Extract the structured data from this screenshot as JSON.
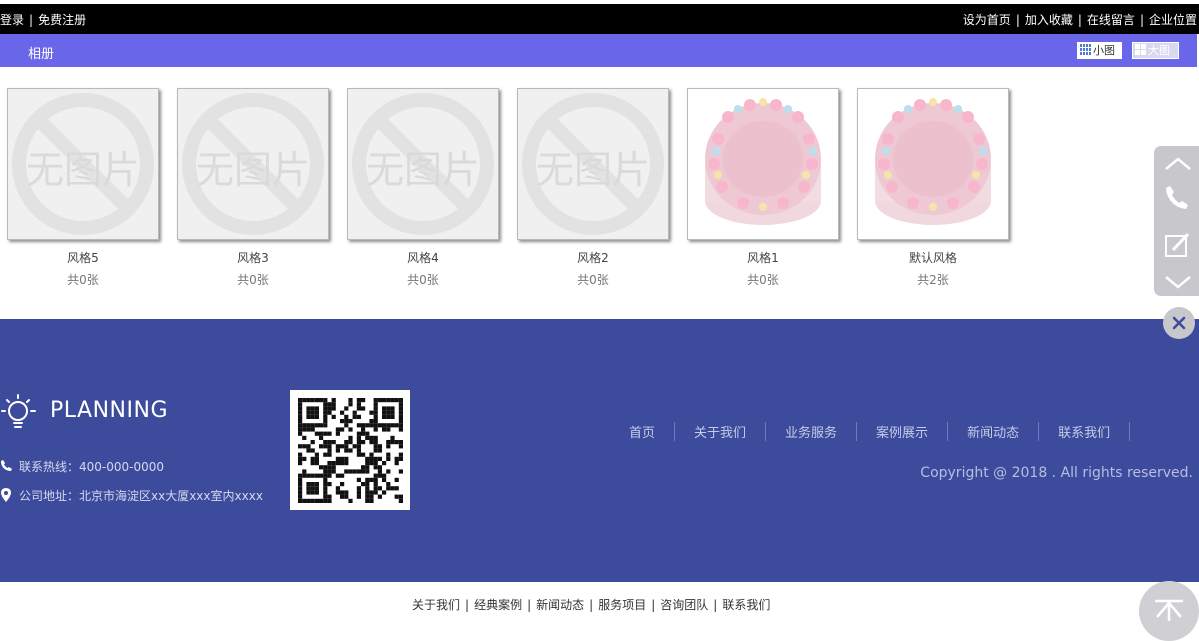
{
  "topbar": {
    "login": "登录",
    "register": "免费注册",
    "set_home": "设为首页",
    "favorite": "加入收藏",
    "message": "在线留言",
    "location": "企业位置",
    "sep": "|"
  },
  "album": {
    "title": "相册",
    "view_small": "小图",
    "view_large": "大图",
    "no_image_text": "无图片",
    "items": [
      {
        "name": "风格5",
        "count": "共0张",
        "image": "no-image"
      },
      {
        "name": "风格3",
        "count": "共0张",
        "image": "no-image"
      },
      {
        "name": "风格4",
        "count": "共0张",
        "image": "no-image"
      },
      {
        "name": "风格2",
        "count": "共0张",
        "image": "no-image"
      },
      {
        "name": "风格1",
        "count": "共0张",
        "image": "cake"
      },
      {
        "name": "默认风格",
        "count": "共2张",
        "image": "cake"
      }
    ]
  },
  "footer": {
    "brand": "PLANNING",
    "hotline": "联系热线：400-000-0000",
    "address": "公司地址：北京市海淀区xx大厦xxx室内xxxx",
    "nav": [
      "首页",
      "关于我们",
      "业务服务",
      "案例展示",
      "新闻动态",
      "联系我们"
    ],
    "copyright": "Copyright @ 2018 . All rights reserved."
  },
  "bottom_nav": {
    "items": [
      "关于我们",
      "经典案例",
      "新闻动态",
      "服务项目",
      "咨询团队",
      "联系我们"
    ],
    "sep": "|"
  },
  "colors": {
    "album_bar": "#6a66e9",
    "footer_bg": "#3c4b9c",
    "topbar_bg": "#000000",
    "side_widget": "#c8c8cc"
  },
  "icons": {
    "side_widget": [
      "chevron-up-icon",
      "phone-icon",
      "edit-icon",
      "chevron-down-icon",
      "close-icon"
    ],
    "back_to_top": "arrow-up-icon",
    "brand": "sun-icon",
    "contact": [
      "phone-icon",
      "location-pin-icon"
    ]
  }
}
